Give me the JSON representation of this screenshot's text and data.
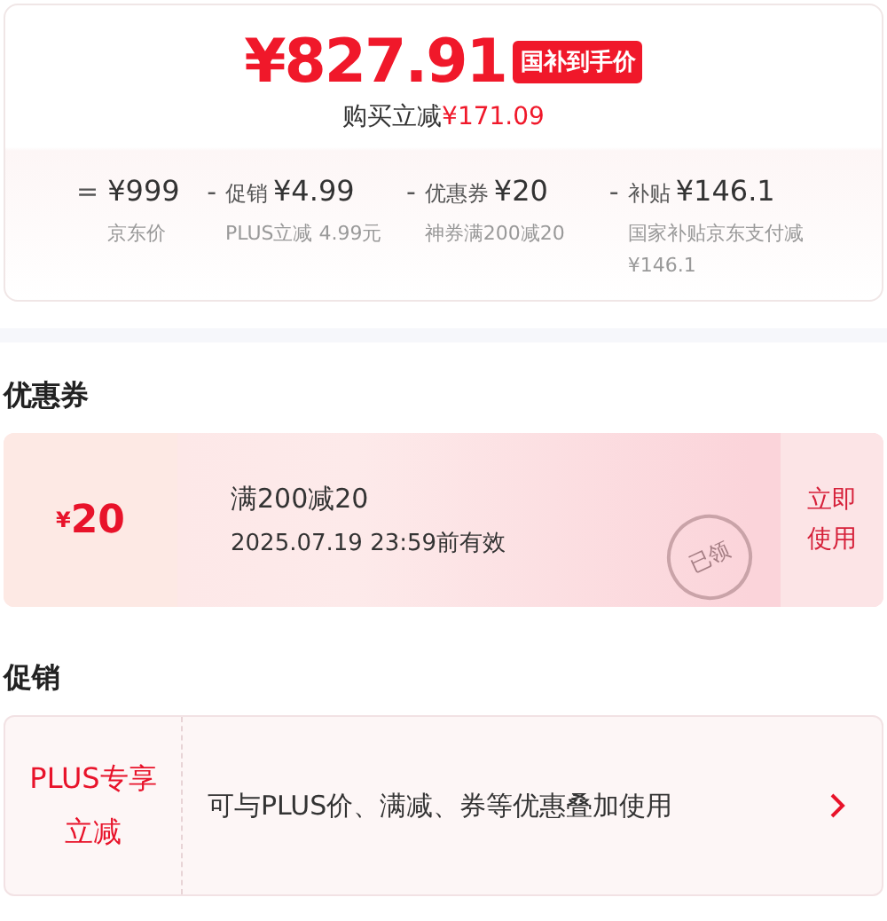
{
  "price": {
    "final_price": "¥827.91",
    "badge": "国补到手价",
    "saving_label": "购买立减",
    "saving_amount": "¥171.09"
  },
  "breakdown": [
    {
      "operator": "=",
      "amount": "¥999",
      "note": "京东价"
    },
    {
      "operator": "-",
      "label": "促销",
      "amount": "¥4.99",
      "note": "PLUS立减 4.99元"
    },
    {
      "operator": "-",
      "label": "优惠券",
      "amount": "¥20",
      "note": "神券满200减20"
    },
    {
      "operator": "-",
      "label": "补贴",
      "amount": "¥146.1",
      "note": "国家补贴京东支付减¥146.1"
    }
  ],
  "coupon_section": {
    "title": "优惠券",
    "coupon": {
      "currency": "¥",
      "value": "20",
      "condition": "满200减20",
      "validity": "2025.07.19 23:59前有效",
      "stamp": "已领",
      "action": "立即使用"
    }
  },
  "promo_section": {
    "title": "促销",
    "promo": {
      "tag": "PLUS专享立减",
      "description": "可与PLUS价、满减、券等优惠叠加使用"
    }
  }
}
